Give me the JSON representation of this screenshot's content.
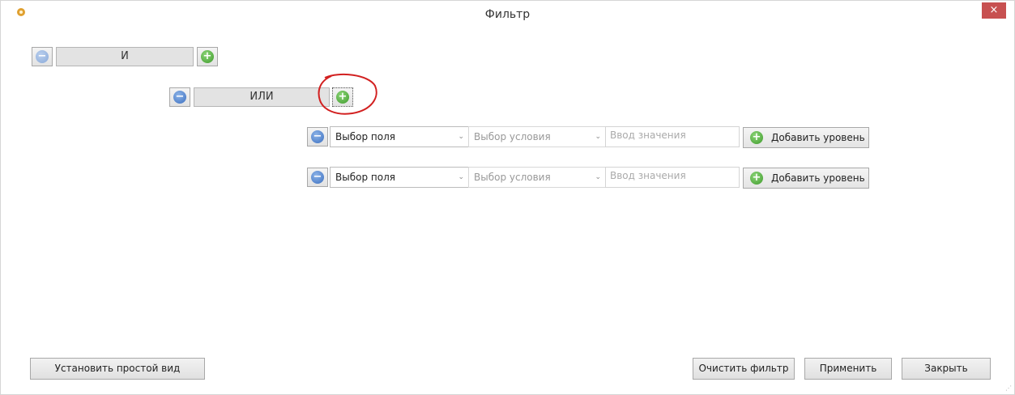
{
  "window": {
    "title": "Фильтр",
    "close_glyph": "×"
  },
  "groups": {
    "and_label": "И",
    "or_label": "ИЛИ"
  },
  "conditions": [
    {
      "field": "Выбор поля",
      "condition": "Выбор условия",
      "value_placeholder": "Ввод значения",
      "add_level": "Добавить уровень"
    },
    {
      "field": "Выбор поля",
      "condition": "Выбор условия",
      "value_placeholder": "Ввод значения",
      "add_level": "Добавить уровень"
    }
  ],
  "footer": {
    "simple_view": "Установить простой вид",
    "clear": "Очистить фильтр",
    "apply": "Применить",
    "close": "Закрыть"
  },
  "glyphs": {
    "minus": "−",
    "plus": "+",
    "arrow": "⌄"
  },
  "icons": {
    "app": "gear-icon",
    "remove": "minus-circle-icon",
    "add": "plus-circle-icon"
  },
  "colors": {
    "close_button": "#c75050",
    "remove_blue": "#3b6fc0",
    "add_green": "#3d9a2a",
    "annotation_red": "#d22020"
  }
}
